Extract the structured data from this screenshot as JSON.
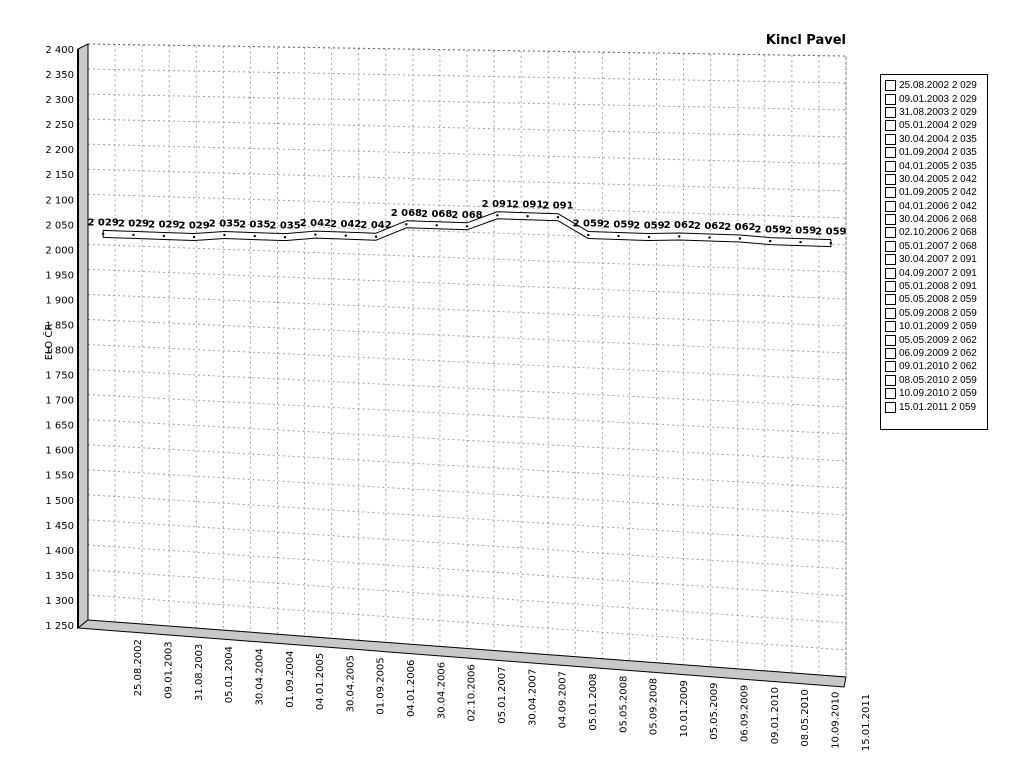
{
  "chart_data": {
    "type": "line",
    "title": "Kincl Pavel",
    "ylabel": "ELO ČR",
    "xlabel": "",
    "ylim": [
      1250,
      2400
    ],
    "ytick_step": 50,
    "grid": true,
    "legend": "right",
    "categories": [
      "25.08.2002",
      "09.01.2003",
      "31.08.2003",
      "05.01.2004",
      "30.04.2004",
      "01.09.2004",
      "04.01.2005",
      "30.04.2005",
      "01.09.2005",
      "04.01.2006",
      "30.04.2006",
      "02.10.2006",
      "05.01.2007",
      "30.04.2007",
      "04.09.2007",
      "05.01.2008",
      "05.05.2008",
      "05.09.2008",
      "10.01.2009",
      "05.05.2009",
      "06.09.2009",
      "09.01.2010",
      "08.05.2010",
      "10.09.2010",
      "15.01.2011"
    ],
    "yticks": [
      "1 250",
      "1 300",
      "1 350",
      "1 400",
      "1 450",
      "1 500",
      "1 550",
      "1 600",
      "1 650",
      "1 700",
      "1 750",
      "1 800",
      "1 850",
      "1 900",
      "1 950",
      "2 000",
      "2 050",
      "2 100",
      "2 150",
      "2 200",
      "2 250",
      "2 300",
      "2 350",
      "2 400"
    ],
    "values": [
      2029,
      2029,
      2029,
      2029,
      2035,
      2035,
      2035,
      2042,
      2042,
      2042,
      2068,
      2068,
      2068,
      2091,
      2091,
      2091,
      2059,
      2059,
      2059,
      2062,
      2062,
      2062,
      2059,
      2059,
      2059
    ],
    "data_labels": [
      "2 029",
      "2 029",
      "2 029",
      "2 029",
      "2 035",
      "2 035",
      "2 035",
      "2 042",
      "2 042",
      "2 042",
      "2 068",
      "2 068",
      "2 068",
      "2 091",
      "2 091",
      "2 091",
      "2 059",
      "2 059",
      "2 059",
      "2 062",
      "2 062",
      "2 062",
      "2 059",
      "2 059",
      "2 059"
    ],
    "legend_entries": [
      "25.08.2002 2 029",
      "09.01.2003 2 029",
      "31.08.2003 2 029",
      "05.01.2004 2 029",
      "30.04.2004 2 035",
      "01.09.2004 2 035",
      "04.01.2005 2 035",
      "30.04.2005 2 042",
      "01.09.2005 2 042",
      "04.01.2006 2 042",
      "30.04.2006 2 068",
      "02.10.2006 2 068",
      "05.01.2007 2 068",
      "30.04.2007 2 091",
      "04.09.2007 2 091",
      "05.01.2008 2 091",
      "05.05.2008 2 059",
      "05.09.2008 2 059",
      "10.01.2009 2 059",
      "05.05.2009 2 062",
      "06.09.2009 2 062",
      "09.01.2010 2 062",
      "08.05.2010 2 059",
      "10.09.2010 2 059",
      "15.01.2011 2 059"
    ],
    "colors": {
      "line": "#000000",
      "ribbon": "#ffffff",
      "wall": "#c8c8c8",
      "grid": "#a0a0a0"
    }
  }
}
